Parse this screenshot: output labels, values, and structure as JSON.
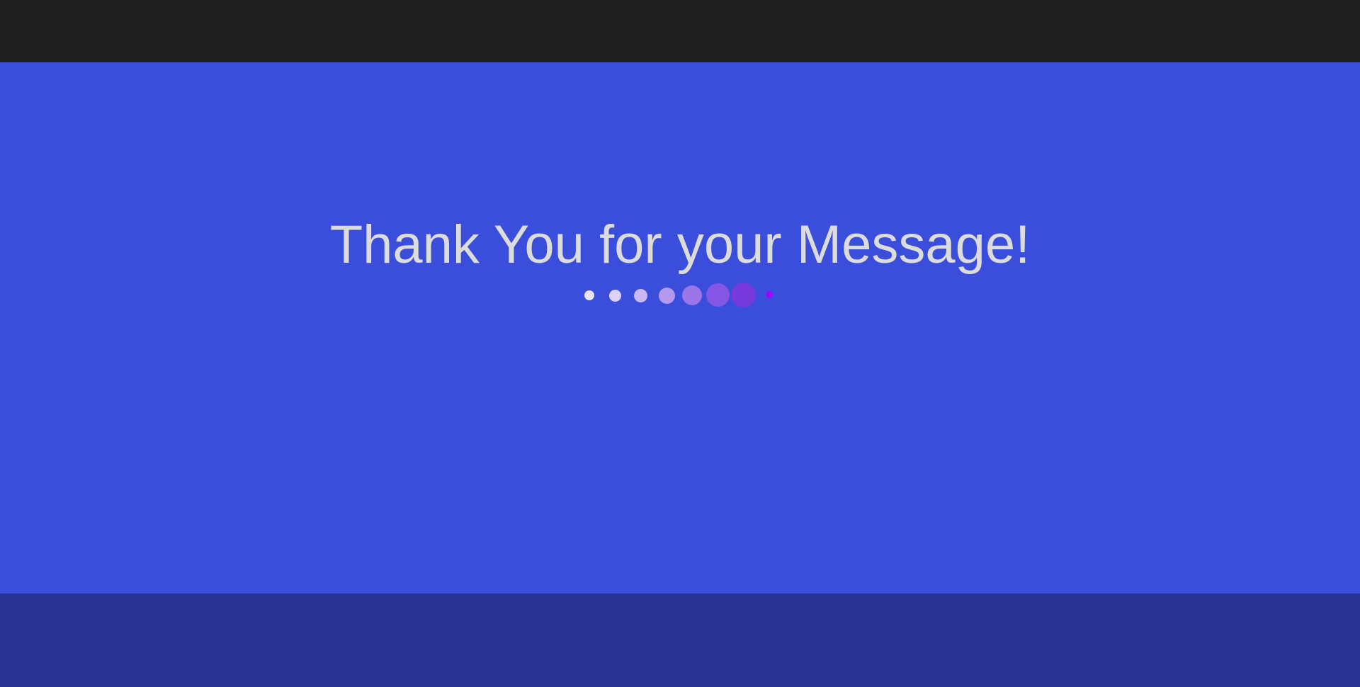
{
  "page": {
    "title": "Thank You for your Message!"
  },
  "colors": {
    "top_bar": "#1e1e1e",
    "main_background": "#3a4edb",
    "footer_background": "#283494",
    "title_text": "#dcdcdc"
  },
  "loader": {
    "icon": "loading-dots",
    "dots": [
      {
        "color": "#e9e3f8"
      },
      {
        "color": "#ddd3f7"
      },
      {
        "color": "#c9b8f2"
      },
      {
        "color": "#b39aee"
      },
      {
        "color": "#9a76e8"
      },
      {
        "color": "#8556e3"
      },
      {
        "color": "#7639dc"
      },
      {
        "color": "#a000ff"
      }
    ]
  }
}
